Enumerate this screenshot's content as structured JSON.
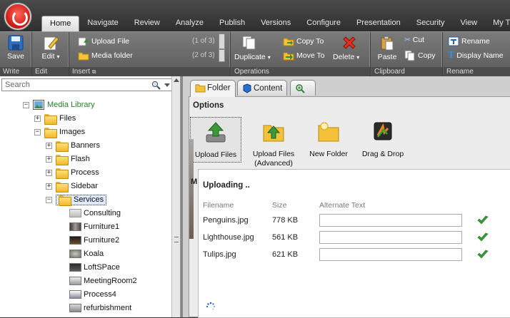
{
  "tabs": [
    "Home",
    "Navigate",
    "Review",
    "Analyze",
    "Publish",
    "Versions",
    "Configure",
    "Presentation",
    "Security",
    "View",
    "My T"
  ],
  "active_tab": "Home",
  "ribbon": {
    "write": {
      "save_label": "Save",
      "group_label": "Write"
    },
    "edit": {
      "edit_label": "Edit",
      "group_label": "Edit"
    },
    "insert": {
      "upload_file_label": "Upload File",
      "upload_file_count": "(1 of 3)",
      "media_folder_label": "Media folder",
      "media_folder_count": "(2 of 3)",
      "group_label": "Insert"
    },
    "operations": {
      "duplicate_label": "Duplicate",
      "copy_to_label": "Copy To",
      "move_to_label": "Move To",
      "delete_label": "Delete",
      "group_label": "Operations"
    },
    "clipboard": {
      "paste_label": "Paste",
      "cut_label": "Cut",
      "copy_label": "Copy",
      "group_label": "Clipboard"
    },
    "rename": {
      "rename_label": "Rename",
      "display_name_label": "Display Name",
      "group_label": "Rename"
    }
  },
  "search": {
    "placeholder": "Search"
  },
  "tree": {
    "root": "Media Library",
    "items": [
      {
        "label": "Files",
        "type": "folder",
        "expander": "+"
      },
      {
        "label": "Images",
        "type": "folder",
        "expander": "−"
      },
      {
        "label": "Banners",
        "type": "folder",
        "expander": "+"
      },
      {
        "label": "Flash",
        "type": "folder",
        "expander": "+"
      },
      {
        "label": "Process",
        "type": "folder",
        "expander": "+"
      },
      {
        "label": "Sidebar",
        "type": "folder",
        "expander": "+"
      },
      {
        "label": "Services",
        "type": "folder",
        "expander": "−",
        "selected": true
      },
      {
        "label": "Consulting",
        "type": "image"
      },
      {
        "label": "Furniture1",
        "type": "image"
      },
      {
        "label": "Furniture2",
        "type": "image"
      },
      {
        "label": "Koala",
        "type": "image"
      },
      {
        "label": "LoftSPace",
        "type": "image"
      },
      {
        "label": "MeetingRoom2",
        "type": "image"
      },
      {
        "label": "Process4",
        "type": "image"
      },
      {
        "label": "refurbishment",
        "type": "image"
      }
    ]
  },
  "content_tabs": {
    "folder": "Folder",
    "content": "Content"
  },
  "options": {
    "title": "Options",
    "buttons": {
      "upload_files": "Upload Files",
      "upload_advanced_1": "Upload Files",
      "upload_advanced_2": "(Advanced)",
      "new_folder": "New Folder",
      "drag_drop": "Drag & Drop"
    }
  },
  "upload": {
    "side_letter": "M",
    "title": "Uploading ..",
    "headers": {
      "filename": "Filename",
      "size": "Size",
      "alt": "Alternate Text"
    },
    "files": [
      {
        "name": "Penguins.jpg",
        "size": "778 KB",
        "alt": ""
      },
      {
        "name": "Lighthouse.jpg",
        "size": "561 KB",
        "alt": ""
      },
      {
        "name": "Tulips.jpg",
        "size": "621 KB",
        "alt": ""
      }
    ]
  }
}
